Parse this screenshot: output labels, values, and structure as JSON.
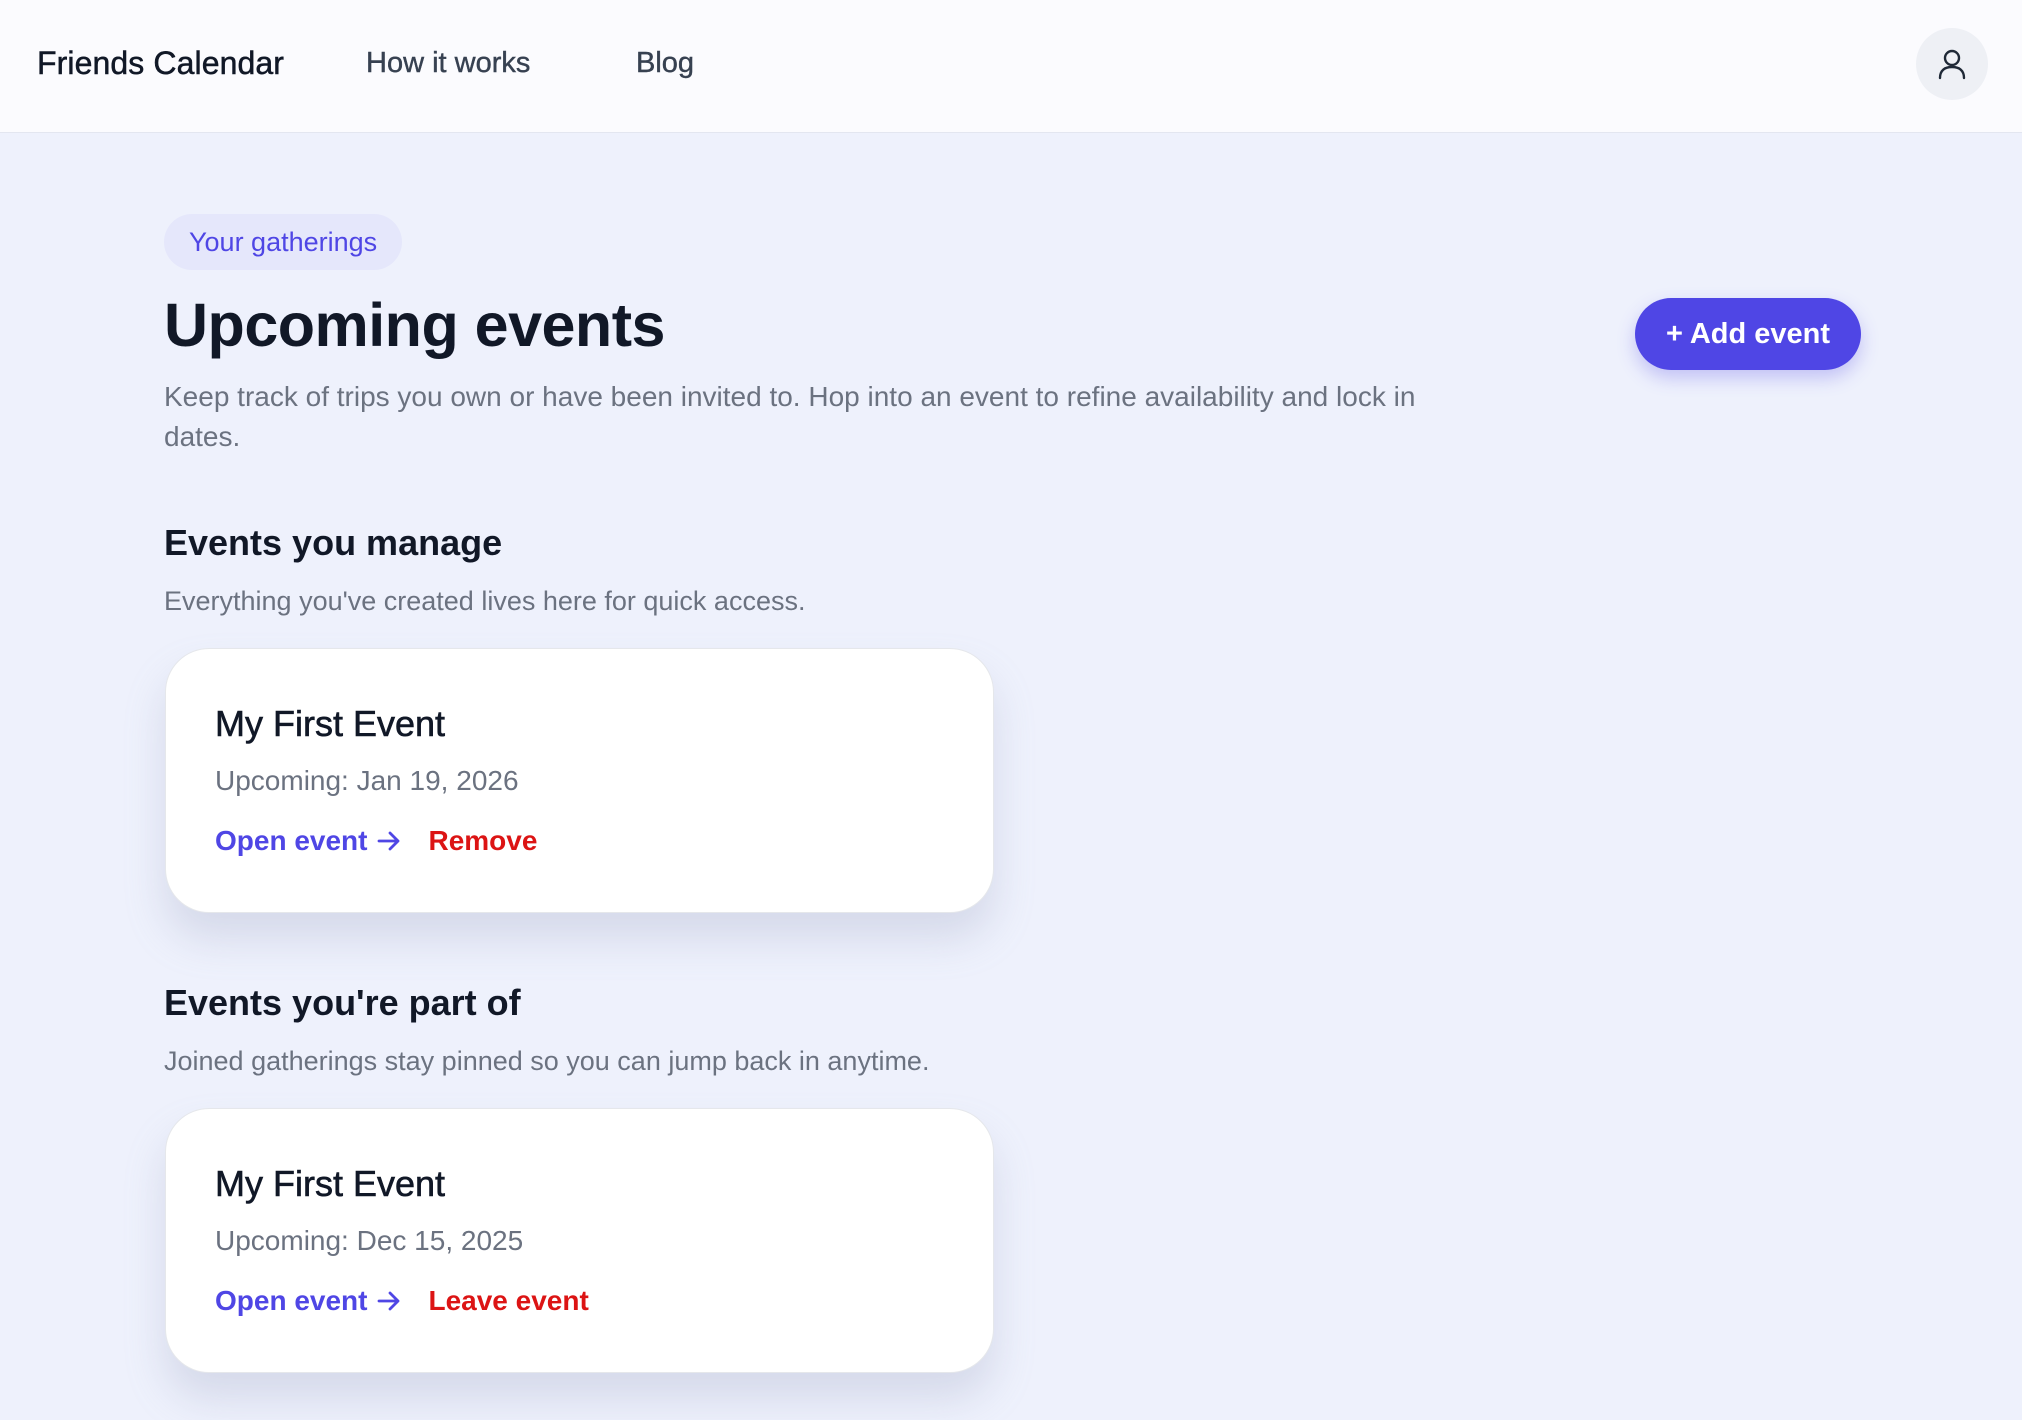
{
  "header": {
    "brand": "Friends Calendar",
    "nav": [
      "How it works",
      "Blog"
    ],
    "account_icon": "user-icon"
  },
  "hero": {
    "eyebrow": "Your gatherings",
    "title": "Upcoming events",
    "description": "Keep track of trips you own or have been invited to. Hop into an event to refine availability and lock in dates.",
    "add_button": "+ Add event"
  },
  "managed": {
    "title": "Events you manage",
    "description": "Everything you've created lives here for quick access.",
    "events": [
      {
        "name": "My First Event",
        "date": "Upcoming: Jan 19, 2026",
        "open_label": "Open event",
        "secondary_label": "Remove"
      }
    ]
  },
  "joined": {
    "title": "Events you're part of",
    "description": "Joined gatherings stay pinned so you can jump back in anytime.",
    "events": [
      {
        "name": "My First Event",
        "date": "Upcoming: Dec 15, 2025",
        "open_label": "Open event",
        "secondary_label": "Leave event"
      }
    ]
  },
  "colors": {
    "accent": "#4f46e5",
    "danger": "#dc1414",
    "background": "#eef1fc"
  }
}
